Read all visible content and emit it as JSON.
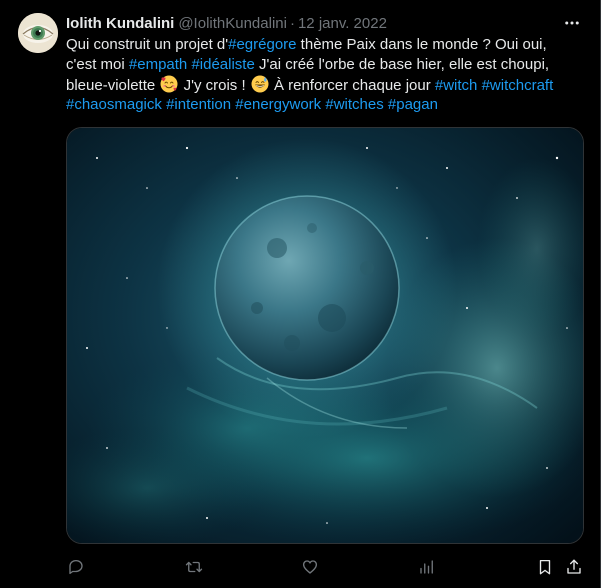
{
  "author": {
    "display_name": "Iolith Kundalini",
    "handle": "@IolithKundalini",
    "separator": "·",
    "date": "12 janv. 2022"
  },
  "tweet": {
    "segments": {
      "s1": "Qui construit un projet d'",
      "h1": "#egrégore",
      "s2": " thème Paix dans le monde ? Oui oui,",
      "s3": "c'est moi ",
      "h2": "#empath",
      "s4": " ",
      "h3": "#idéaliste",
      "s5": " J'ai créé l'orbe de base hier, elle est choupi,",
      "s6": "bleue-violette ",
      "s7": " J'y crois ! ",
      "s8": " À renforcer chaque jour ",
      "h4": "#witch",
      "s9": " ",
      "h5": "#witchcraft",
      "h6": "#chaosmagick",
      "s10": " ",
      "h7": "#intention",
      "s11": " ",
      "h8": "#energywork",
      "s12": " ",
      "h9": "#witches",
      "s13": " ",
      "h10": "#pagan"
    },
    "emojis": [
      "smiling-face-with-hearts",
      "grinning-face-with-sweat"
    ]
  },
  "icons": {
    "more": "more-horizontal-icon",
    "reply": "reply-icon",
    "retweet": "retweet-icon",
    "like": "like-icon",
    "views": "views-icon",
    "bookmark": "bookmark-icon",
    "share": "share-icon"
  },
  "colors": {
    "background": "#000000",
    "text": "#e7e9ea",
    "secondary": "#71767b",
    "link": "#1d9bf0",
    "border": "#2f3336"
  }
}
